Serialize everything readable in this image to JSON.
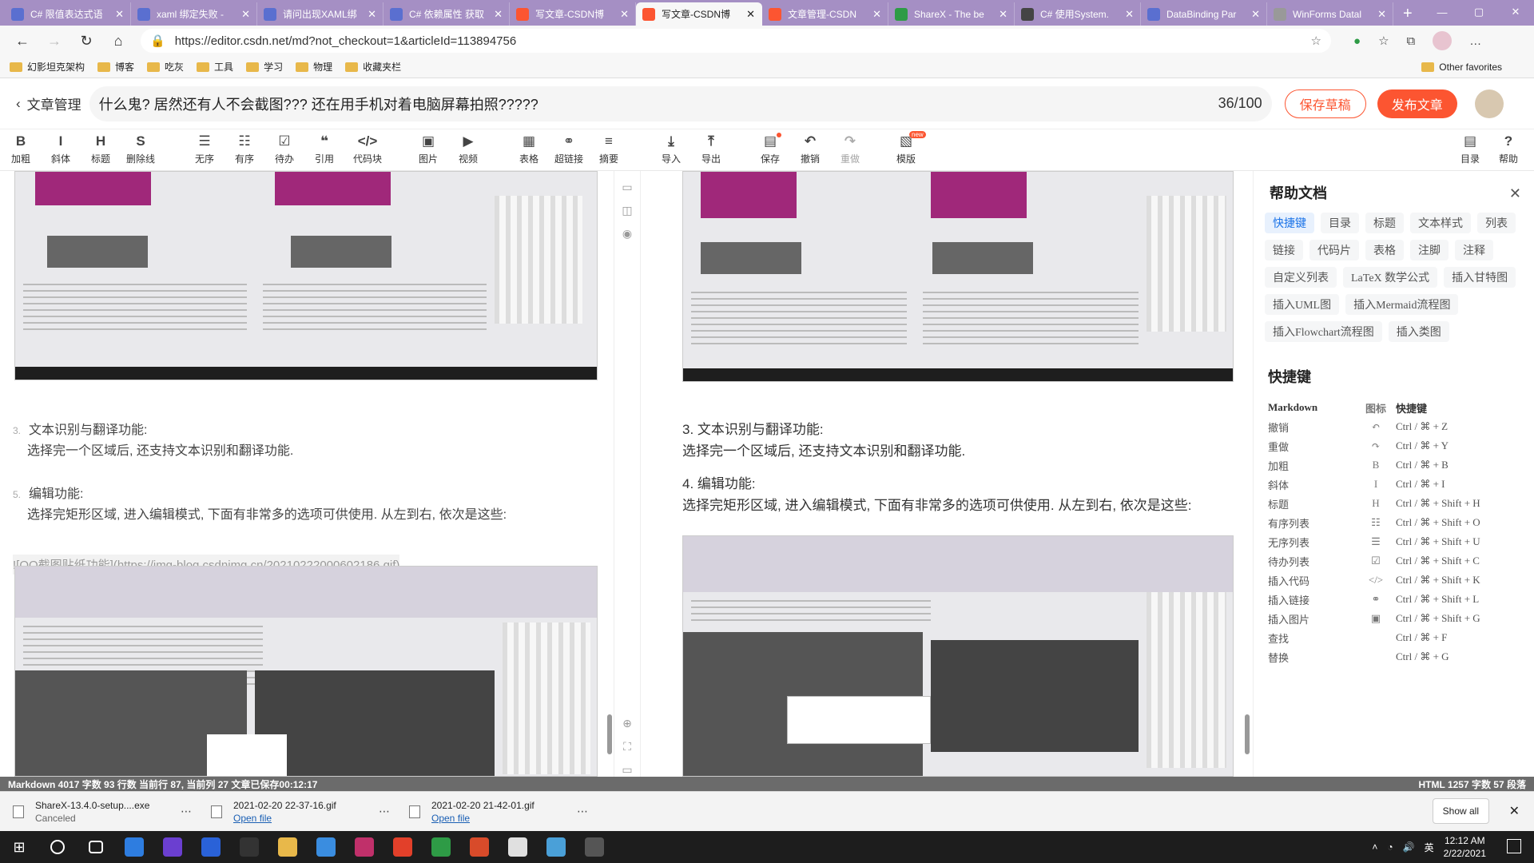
{
  "browser": {
    "tabs": [
      {
        "title": "C# 限值表达式语",
        "icon": "vs-icon",
        "color": "#5a6fd0",
        "active": false
      },
      {
        "title": "xaml 绑定失败 -",
        "icon": "vs-icon",
        "color": "#5a6fd0",
        "active": false
      },
      {
        "title": "请问出现XAML绑",
        "icon": "vs-icon",
        "color": "#5a6fd0",
        "active": false
      },
      {
        "title": "C# 依赖属性 获取",
        "icon": "vs-icon",
        "color": "#5a6fd0",
        "active": false
      },
      {
        "title": "写文章-CSDN博",
        "icon": "csdn-icon",
        "color": "#fc5531",
        "active": false
      },
      {
        "title": "写文章-CSDN博",
        "icon": "csdn-icon",
        "color": "#fc5531",
        "active": true
      },
      {
        "title": "文章管理-CSDN",
        "icon": "csdn-icon",
        "color": "#fc5531",
        "active": false
      },
      {
        "title": "ShareX - The be",
        "icon": "chrome-icon",
        "color": "#2e9b46",
        "active": false
      },
      {
        "title": "C# 使用System.",
        "icon": "github-icon",
        "color": "#444",
        "active": false
      },
      {
        "title": "DataBinding Par",
        "icon": "vs-icon",
        "color": "#5a6fd0",
        "active": false
      },
      {
        "title": "WinForms Datal",
        "icon": "wiki-icon",
        "color": "#999",
        "active": false
      }
    ],
    "url": "https://editor.csdn.net/md?not_checkout=1&articleId=113894756",
    "bookmarks": [
      "幻影坦克架构",
      "博客",
      "吃灰",
      "工具",
      "学习",
      "物理",
      "收藏夹栏"
    ],
    "other_favorites": "Other favorites"
  },
  "header": {
    "back_label": "文章管理",
    "title": "什么鬼? 居然还有人不会截图??? 还在用手机对着电脑屏幕拍照?????",
    "count": "36/100",
    "save_label": "保存草稿",
    "publish_label": "发布文章"
  },
  "toolbar": [
    {
      "label": "加粗",
      "glyph": "B"
    },
    {
      "label": "斜体",
      "glyph": "I"
    },
    {
      "label": "标题",
      "glyph": "H"
    },
    {
      "label": "删除线",
      "glyph": "S"
    },
    {
      "label": "无序",
      "glyph": "☰"
    },
    {
      "label": "有序",
      "glyph": "☷"
    },
    {
      "label": "待办",
      "glyph": "☑"
    },
    {
      "label": "引用",
      "glyph": "❝"
    },
    {
      "label": "代码块",
      "glyph": "</>"
    },
    {
      "label": "图片",
      "glyph": "▣"
    },
    {
      "label": "视频",
      "glyph": "▶"
    },
    {
      "label": "表格",
      "glyph": "▦"
    },
    {
      "label": "超链接",
      "glyph": "⚭"
    },
    {
      "label": "摘要",
      "glyph": "≡"
    },
    {
      "label": "导入",
      "glyph": "⤓"
    },
    {
      "label": "导出",
      "glyph": "⤒"
    },
    {
      "label": "保存",
      "glyph": "▤"
    },
    {
      "label": "撤销",
      "glyph": "↶"
    },
    {
      "label": "重做",
      "glyph": "↷"
    },
    {
      "label": "模版",
      "glyph": "▧"
    },
    {
      "label": "目录",
      "glyph": "▤"
    },
    {
      "label": "帮助",
      "glyph": "?"
    }
  ],
  "toolbar_new_badge": "new",
  "editor": {
    "link": "![QQ截图贴纸功能](https://img-blog.csdnimg.cn/20210222000602186.gif)",
    "item3_num": "3.",
    "item3_title": "文本识别与翻译功能:",
    "item3_body": "选择完一个区域后, 还支持文本识别和翻译功能.",
    "item5_num": "5.",
    "item5_title": "编辑功能:",
    "item5_body": "选择完矩形区域, 进入编辑模式, 下面有非常多的选项可供使用. 从左到右, 依次是这些:"
  },
  "preview": {
    "item3_title": "3. 文本识别与翻译功能:",
    "item3_body": "选择完一个区域后, 还支持文本识别和翻译功能.",
    "item4_title": "4. 编辑功能:",
    "item4_body": "选择完矩形区域, 进入编辑模式, 下面有非常多的选项可供使用. 从左到右, 依次是这些:"
  },
  "help": {
    "title": "帮助文档",
    "chips": [
      "快捷键",
      "目录",
      "标题",
      "文本样式",
      "列表",
      "链接",
      "代码片",
      "表格",
      "注脚",
      "注释",
      "自定义列表",
      "LaTeX 数学公式",
      "插入甘特图",
      "插入UML图",
      "插入Mermaid流程图",
      "插入Flowchart流程图",
      "插入类图"
    ],
    "shortcut_title": "快捷键",
    "columns": [
      "Markdown",
      "图标",
      "快捷键"
    ],
    "shortcuts": [
      {
        "name": "撤销",
        "icon": "↶",
        "keys": "Ctrl / ⌘ + Z"
      },
      {
        "name": "重做",
        "icon": "↷",
        "keys": "Ctrl / ⌘ + Y"
      },
      {
        "name": "加粗",
        "icon": "B",
        "keys": "Ctrl / ⌘ + B"
      },
      {
        "name": "斜体",
        "icon": "I",
        "keys": "Ctrl / ⌘ + I"
      },
      {
        "name": "标题",
        "icon": "H",
        "keys": "Ctrl / ⌘ + Shift + H"
      },
      {
        "name": "有序列表",
        "icon": "☷",
        "keys": "Ctrl / ⌘ + Shift + O"
      },
      {
        "name": "无序列表",
        "icon": "☰",
        "keys": "Ctrl / ⌘ + Shift + U"
      },
      {
        "name": "待办列表",
        "icon": "☑",
        "keys": "Ctrl / ⌘ + Shift + C"
      },
      {
        "name": "插入代码",
        "icon": "</>",
        "keys": "Ctrl / ⌘ + Shift + K"
      },
      {
        "name": "插入链接",
        "icon": "⚭",
        "keys": "Ctrl / ⌘ + Shift + L"
      },
      {
        "name": "插入图片",
        "icon": "▣",
        "keys": "Ctrl / ⌘ + Shift + G"
      },
      {
        "name": "查找",
        "icon": "",
        "keys": "Ctrl / ⌘ + F"
      },
      {
        "name": "替换",
        "icon": "",
        "keys": "Ctrl / ⌘ + G"
      }
    ]
  },
  "status": {
    "left": "Markdown  4017 字数  93 行数  当前行 87, 当前列 27  文章已保存00:12:17",
    "right": "HTML  1257 字数  57 段落"
  },
  "downloads": [
    {
      "name": "ShareX-13.4.0-setup....exe",
      "sub": "Canceled",
      "link": false
    },
    {
      "name": "2021-02-20 22-37-16.gif",
      "sub": "Open file",
      "link": true
    },
    {
      "name": "2021-02-20 21-42-01.gif",
      "sub": "Open file",
      "link": true
    }
  ],
  "show_all": "Show all",
  "taskbar": {
    "time": "12:12 AM",
    "date": "2/22/2021",
    "ime": "英",
    "apps": [
      "#2e7de0",
      "#6b3fd0",
      "#2a62d8",
      "#333",
      "#e8b84a",
      "#3a8de0",
      "#c0306a",
      "#e2402a",
      "#2e9b46",
      "#d84b2a",
      "#e0e0e0",
      "#4aa0d8",
      "#555"
    ]
  }
}
